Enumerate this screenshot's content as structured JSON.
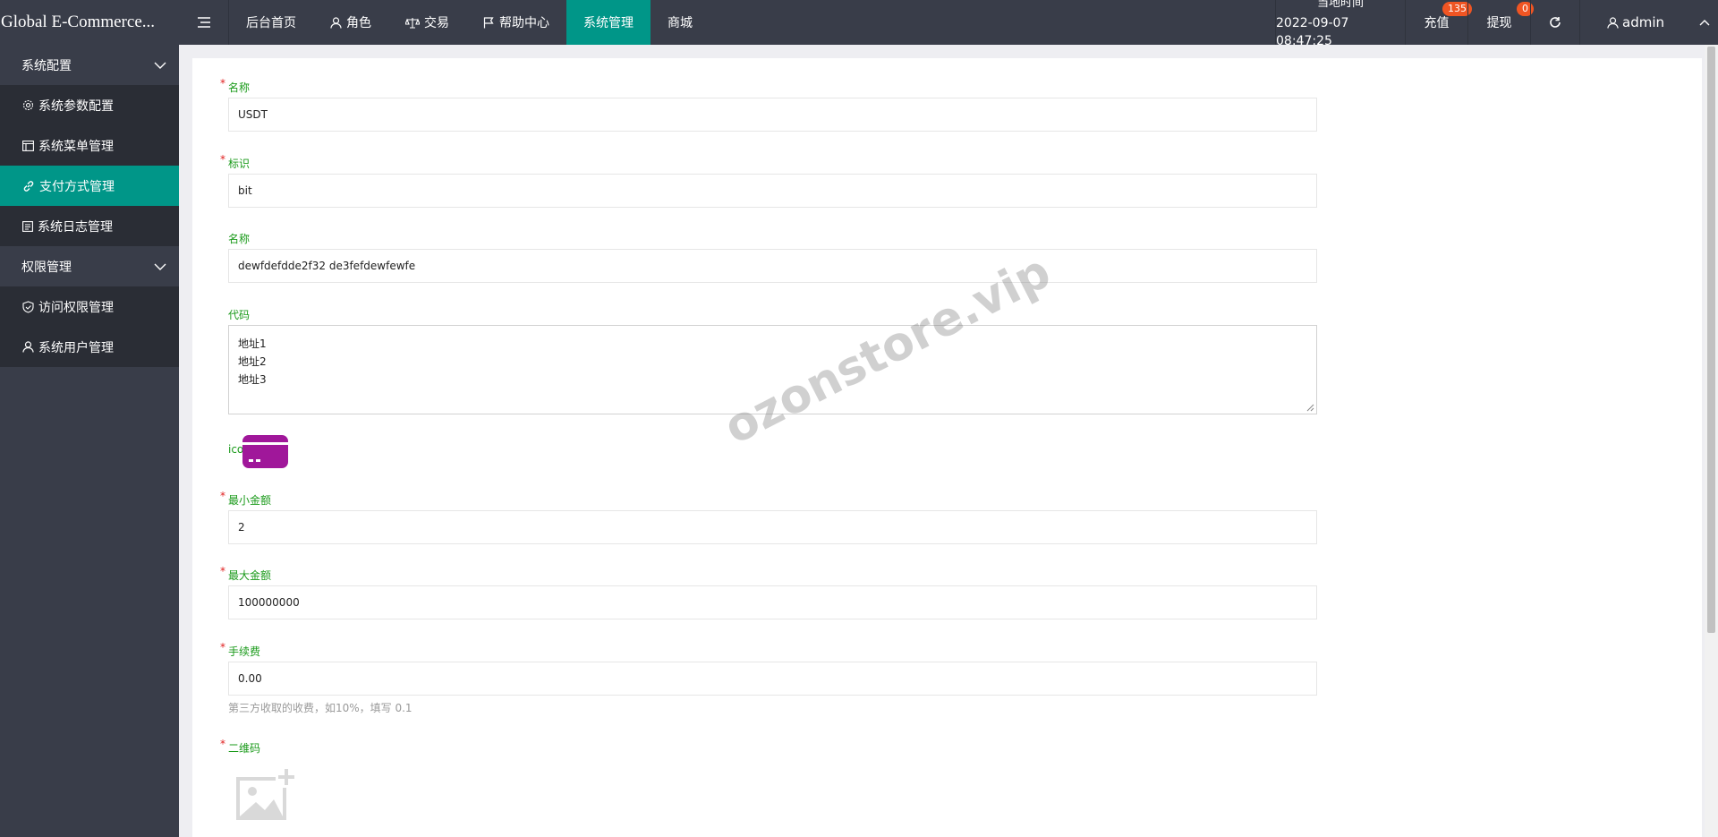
{
  "header": {
    "brand": "Global E-Commerce...",
    "nav": [
      "后台首页",
      "角色",
      "交易",
      "帮助中心",
      "系统管理",
      "商城"
    ],
    "active_nav": "系统管理",
    "time_label": "当地时间",
    "time_value": "2022-09-07 08:47:25",
    "recharge_label": "充值",
    "recharge_count": "135",
    "withdraw_label": "提现",
    "withdraw_count": "0",
    "user": "admin"
  },
  "sidebar": {
    "groups": [
      {
        "title": "系统配置",
        "items": [
          "系统参数配置",
          "系统菜单管理",
          "支付方式管理",
          "系统日志管理"
        ]
      },
      {
        "title": "权限管理",
        "items": [
          "访问权限管理",
          "系统用户管理"
        ]
      }
    ],
    "active_item": "支付方式管理"
  },
  "form": {
    "name_label": "名称",
    "name_value": "USDT",
    "ident_label": "标识",
    "ident_value": "bit",
    "name2_label": "名称",
    "name2_value": "dewfdefdde2f32 de3fefdewfewfe",
    "code_label": "代码",
    "code_lines": [
      "地址1",
      "地址2",
      "地址3"
    ],
    "ico_label": "ico",
    "min_label": "最小金额",
    "min_value": "2",
    "max_label": "最大金额",
    "max_value": "100000000",
    "fee_label": "手续费",
    "fee_value": "0.00",
    "fee_hint": "第三方收取的收费，如10%，填写 0.1",
    "qr_label": "二维码"
  },
  "watermark": "ozonstore.vip",
  "colors": {
    "accent": "#009688",
    "header_bg": "#393d49",
    "sidebar_sub_bg": "#2a2d35",
    "label_green": "#1a9a1a",
    "badge": "#f05523",
    "ico_card": "#a0179a"
  }
}
